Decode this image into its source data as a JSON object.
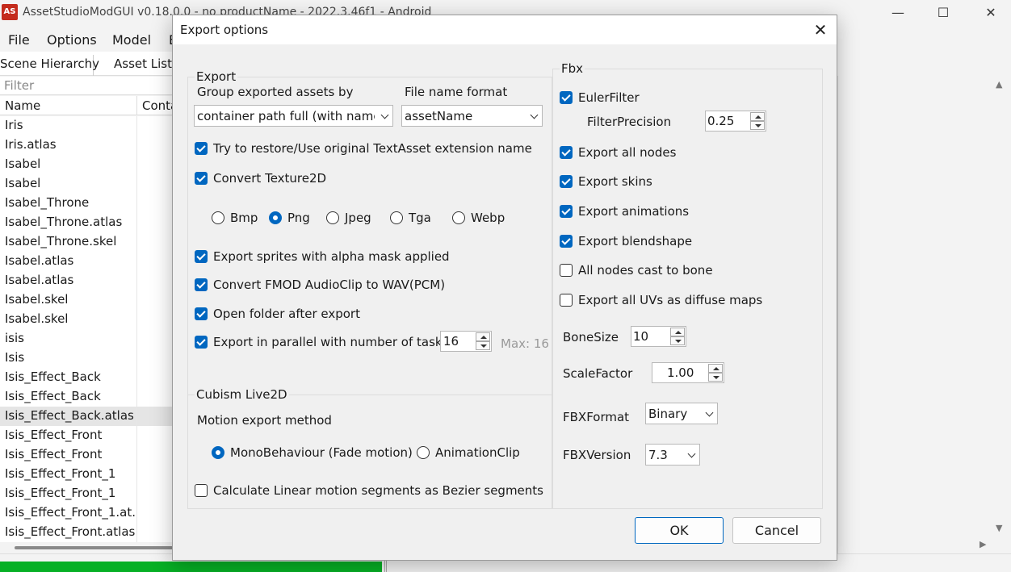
{
  "main": {
    "title": "AssetStudioModGUI v0.18.0.0 - no productName - 2022.3.46f1 - Android",
    "icon_text": "AS",
    "window_controls": [
      "—",
      "☐",
      "✕"
    ],
    "menu": [
      "File",
      "Options",
      "Model",
      "E"
    ],
    "tabs": [
      "Scene Hierarchy",
      "Asset List"
    ],
    "filter_placeholder": "Filter",
    "columns": [
      "Name",
      "Conta"
    ],
    "assets": [
      "Iris",
      "Iris.atlas",
      "Isabel",
      "Isabel",
      "Isabel_Throne",
      "Isabel_Throne.atlas",
      "Isabel_Throne.skel",
      "Isabel.atlas",
      "Isabel.atlas",
      "Isabel.skel",
      "Isabel.skel",
      "isis",
      "Isis",
      "Isis_Effect_Back",
      "Isis_Effect_Back",
      "Isis_Effect_Back.atlas",
      "Isis_Effect_Front",
      "Isis_Effect_Front",
      "Isis_Effect_Front_1",
      "Isis_Effect_Front_1",
      "Isis_Effect_Front_1.at...",
      "Isis_Effect_Front.atlas"
    ],
    "selected_asset_index": 15,
    "progress_percent": 100
  },
  "dialog": {
    "title": "Export options",
    "close_glyph": "✕",
    "export": {
      "title": "Export",
      "group_by_label": "Group exported assets by",
      "group_by_value": "container path full (with name)",
      "file_name_format_label": "File name format",
      "file_name_format_value": "assetName",
      "restore_ext_label": "Try to restore/Use original TextAsset extension name",
      "restore_ext_checked": true,
      "convert_texture_label": "Convert Texture2D",
      "convert_texture_checked": true,
      "formats": [
        "Bmp",
        "Png",
        "Jpeg",
        "Tga",
        "Webp"
      ],
      "selected_format": "Png",
      "sprites_alpha_label": "Export sprites with alpha mask applied",
      "sprites_alpha_checked": true,
      "fmod_label": "Convert FMOD AudioClip to WAV(PCM)",
      "fmod_checked": true,
      "open_folder_label": "Open folder after export",
      "open_folder_checked": true,
      "parallel_label": "Export in parallel with number of tasks",
      "parallel_checked": true,
      "parallel_tasks": "16",
      "max_label": "Max: 16"
    },
    "live2d": {
      "title": "Cubism Live2D",
      "motion_label": "Motion export method",
      "motion_options": [
        "MonoBehaviour (Fade motion)",
        "AnimationClip"
      ],
      "motion_selected": "MonoBehaviour (Fade motion)",
      "bezier_label": "Calculate Linear motion segments as Bezier segments",
      "bezier_checked": false
    },
    "fbx": {
      "title": "Fbx",
      "euler_label": "EulerFilter",
      "euler_checked": true,
      "filter_precision_label": "FilterPrecision",
      "filter_precision_value": "0.25",
      "all_nodes_label": "Export all nodes",
      "all_nodes_checked": true,
      "skins_label": "Export skins",
      "skins_checked": true,
      "animations_label": "Export animations",
      "animations_checked": true,
      "blendshape_label": "Export blendshape",
      "blendshape_checked": true,
      "cast_bone_label": "All nodes cast to bone",
      "cast_bone_checked": false,
      "uvs_label": "Export all UVs as diffuse maps",
      "uvs_checked": false,
      "bone_size_label": "BoneSize",
      "bone_size_value": "10",
      "scale_factor_label": "ScaleFactor",
      "scale_factor_value": "1.00",
      "fbx_format_label": "FBXFormat",
      "fbx_format_value": "Binary",
      "fbx_version_label": "FBXVersion",
      "fbx_version_value": "7.3"
    },
    "ok_label": "OK",
    "cancel_label": "Cancel"
  },
  "colors": {
    "accent": "#0067c0",
    "progress": "#06b025",
    "app_icon": "#c42b1c"
  }
}
